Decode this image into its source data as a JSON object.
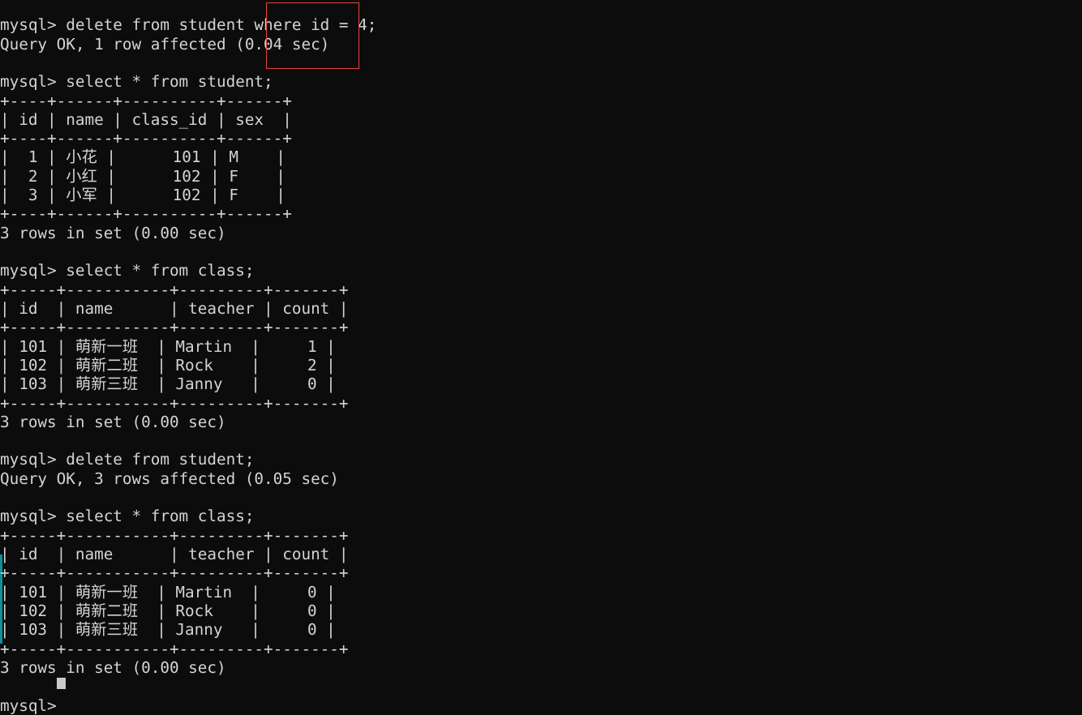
{
  "terminal": {
    "prompt": "mysql>",
    "background_color": "#0c0c0c",
    "text_color": "#d4d4d4",
    "cursor": {
      "shape": "block",
      "color": "#c9c9c9"
    },
    "scrollbar_color": "#11a8b5",
    "lines": [
      "mysql> delete from student where id = 4;",
      "Query OK, 1 row affected (0.04 sec)",
      "",
      "mysql> select * from student;",
      "+----+------+----------+------+",
      "| id | name | class_id | sex  |",
      "+----+------+----------+------+",
      "|  1 | 小花 |      101 | M    |",
      "|  2 | 小红 |      102 | F    |",
      "|  3 | 小军 |      102 | F    |",
      "+----+------+----------+------+",
      "3 rows in set (0.00 sec)",
      "",
      "mysql> select * from class;",
      "+-----+-----------+---------+-------+",
      "| id  | name      | teacher | count |",
      "+-----+-----------+---------+-------+",
      "| 101 | 萌新一班  | Martin  |     1 |",
      "| 102 | 萌新二班  | Rock    |     2 |",
      "| 103 | 萌新三班  | Janny   |     0 |",
      "+-----+-----------+---------+-------+",
      "3 rows in set (0.00 sec)",
      "",
      "mysql> delete from student;",
      "Query OK, 3 rows affected (0.05 sec)",
      "",
      "mysql> select * from class;",
      "+-----+-----------+---------+-------+",
      "| id  | name      | teacher | count |",
      "+-----+-----------+---------+-------+",
      "| 101 | 萌新一班  | Martin  |     0 |",
      "| 102 | 萌新二班  | Rock    |     0 |",
      "| 103 | 萌新三班  | Janny   |     0 |",
      "+-----+-----------+---------+-------+",
      "3 rows in set (0.00 sec)",
      "",
      "mysql> "
    ]
  },
  "commands": [
    {
      "prompt": "mysql>",
      "sql": "delete from student where id = 4;",
      "result": "Query OK, 1 row affected (0.04 sec)"
    },
    {
      "prompt": "mysql>",
      "sql": "select * from student;",
      "result": "3 rows in set (0.00 sec)"
    },
    {
      "prompt": "mysql>",
      "sql": "select * from class;",
      "result": "3 rows in set (0.00 sec)"
    },
    {
      "prompt": "mysql>",
      "sql": "delete from student;",
      "result": "Query OK, 3 rows affected (0.05 sec)"
    },
    {
      "prompt": "mysql>",
      "sql": "select * from class;",
      "result": "3 rows in set (0.00 sec)"
    }
  ],
  "tables": {
    "student": {
      "columns": [
        "id",
        "name",
        "class_id",
        "sex"
      ],
      "rows": [
        [
          "1",
          "小花",
          "101",
          "M"
        ],
        [
          "2",
          "小红",
          "102",
          "F"
        ],
        [
          "3",
          "小军",
          "102",
          "F"
        ]
      ],
      "row_count_text": "3 rows in set (0.00 sec)"
    },
    "class_before": {
      "columns": [
        "id",
        "name",
        "teacher",
        "count"
      ],
      "rows": [
        [
          "101",
          "萌新一班",
          "Martin",
          "1"
        ],
        [
          "102",
          "萌新二班",
          "Rock",
          "2"
        ],
        [
          "103",
          "萌新三班",
          "Janny",
          "0"
        ]
      ],
      "row_count_text": "3 rows in set (0.00 sec)"
    },
    "class_after": {
      "columns": [
        "id",
        "name",
        "teacher",
        "count"
      ],
      "rows": [
        [
          "101",
          "萌新一班",
          "Martin",
          "0"
        ],
        [
          "102",
          "萌新二班",
          "Rock",
          "0"
        ],
        [
          "103",
          "萌新三班",
          "Janny",
          "0"
        ]
      ],
      "row_count_text": "3 rows in set (0.00 sec)"
    }
  },
  "annotation": {
    "type": "rectangle",
    "color": "#e8453c",
    "highlights_text": "id = 4;"
  }
}
